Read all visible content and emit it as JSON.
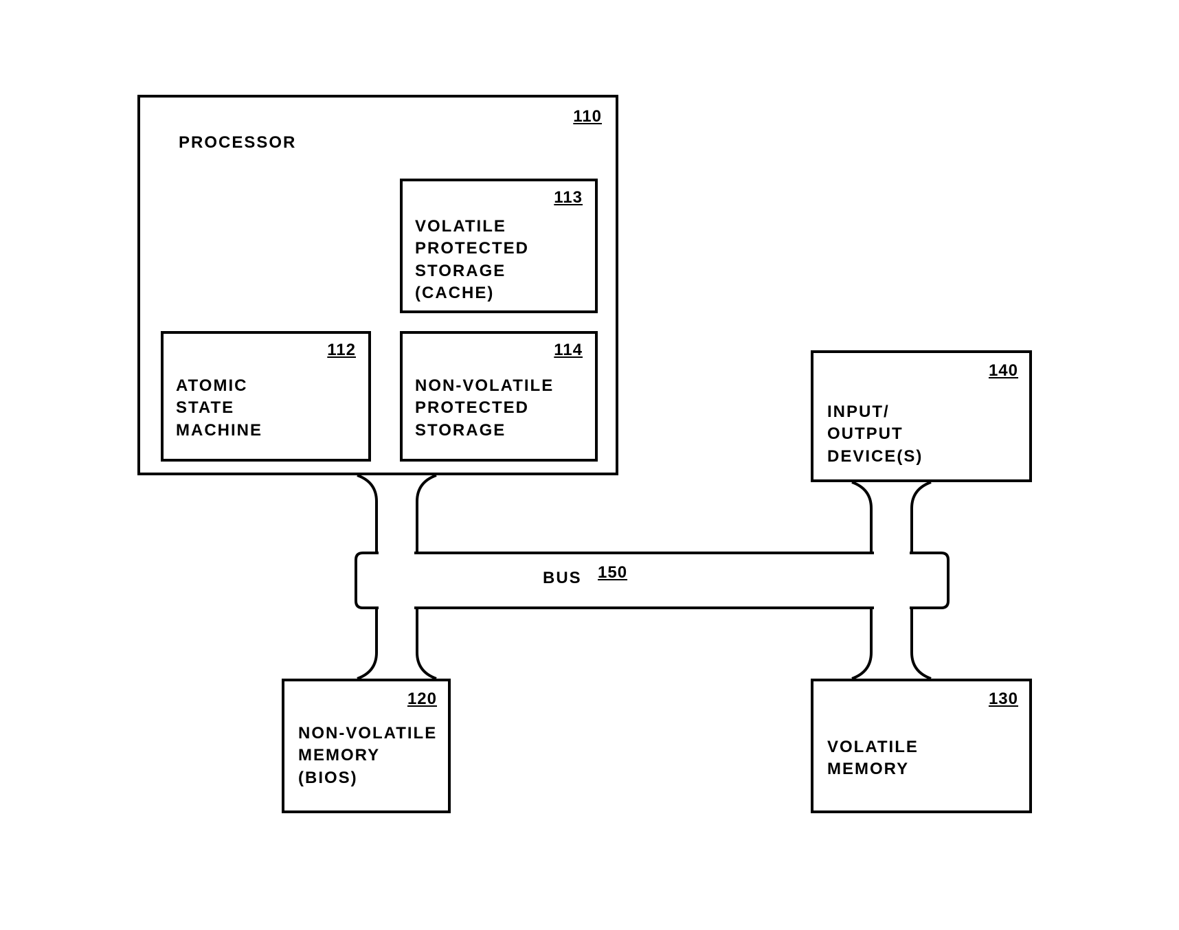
{
  "processor": {
    "ref": "110",
    "title": "PROCESSOR",
    "vps": {
      "ref": "113",
      "label": "VOLATILE\nPROTECTED\nSTORAGE\n(CACHE)"
    },
    "asm": {
      "ref": "112",
      "label": "ATOMIC\nSTATE\nMACHINE"
    },
    "nvps": {
      "ref": "114",
      "label": "NON-VOLATILE\nPROTECTED\nSTORAGE"
    }
  },
  "io": {
    "ref": "140",
    "label": "INPUT/\nOUTPUT\nDEVICE(S)"
  },
  "nvmem": {
    "ref": "120",
    "label": "NON-VOLATILE\nMEMORY\n(BIOS)"
  },
  "vmem": {
    "ref": "130",
    "label": "VOLATILE\nMEMORY"
  },
  "bus": {
    "ref": "150",
    "label": "BUS"
  }
}
